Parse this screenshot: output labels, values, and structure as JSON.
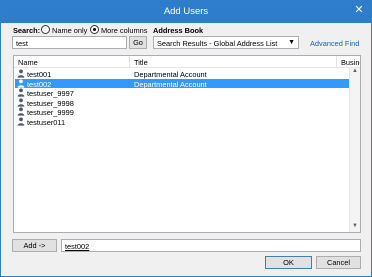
{
  "window": {
    "title": "Add Users",
    "close_glyph": "✕"
  },
  "search": {
    "label": "Search:",
    "option_name_only": "Name only",
    "option_more_columns": "More columns",
    "selected": "More columns",
    "value": "test",
    "go_label": "Go"
  },
  "address_book": {
    "label": "Address Book",
    "selected": "Search Results - Global Address List",
    "advanced_find": "Advanced Find"
  },
  "list": {
    "columns": [
      "Name",
      "Title",
      "Busine"
    ],
    "rows": [
      {
        "name": "test001",
        "title": "Departmental Account",
        "selected": false
      },
      {
        "name": "test002",
        "title": "Departmental Account",
        "selected": true
      },
      {
        "name": "testuser_9997",
        "title": "",
        "selected": false
      },
      {
        "name": "testuser_9998",
        "title": "",
        "selected": false
      },
      {
        "name": "testuser_9999",
        "title": "",
        "selected": false
      },
      {
        "name": "testuser011",
        "title": "",
        "selected": false
      }
    ],
    "row_icon": "person-icon"
  },
  "add": {
    "button_label": "Add ->",
    "value": "test002"
  },
  "footer": {
    "ok_label": "OK",
    "cancel_label": "Cancel"
  },
  "colors": {
    "titlebar": "#2e7dcc",
    "selection": "#3399ff",
    "link": "#1a5fb4"
  }
}
